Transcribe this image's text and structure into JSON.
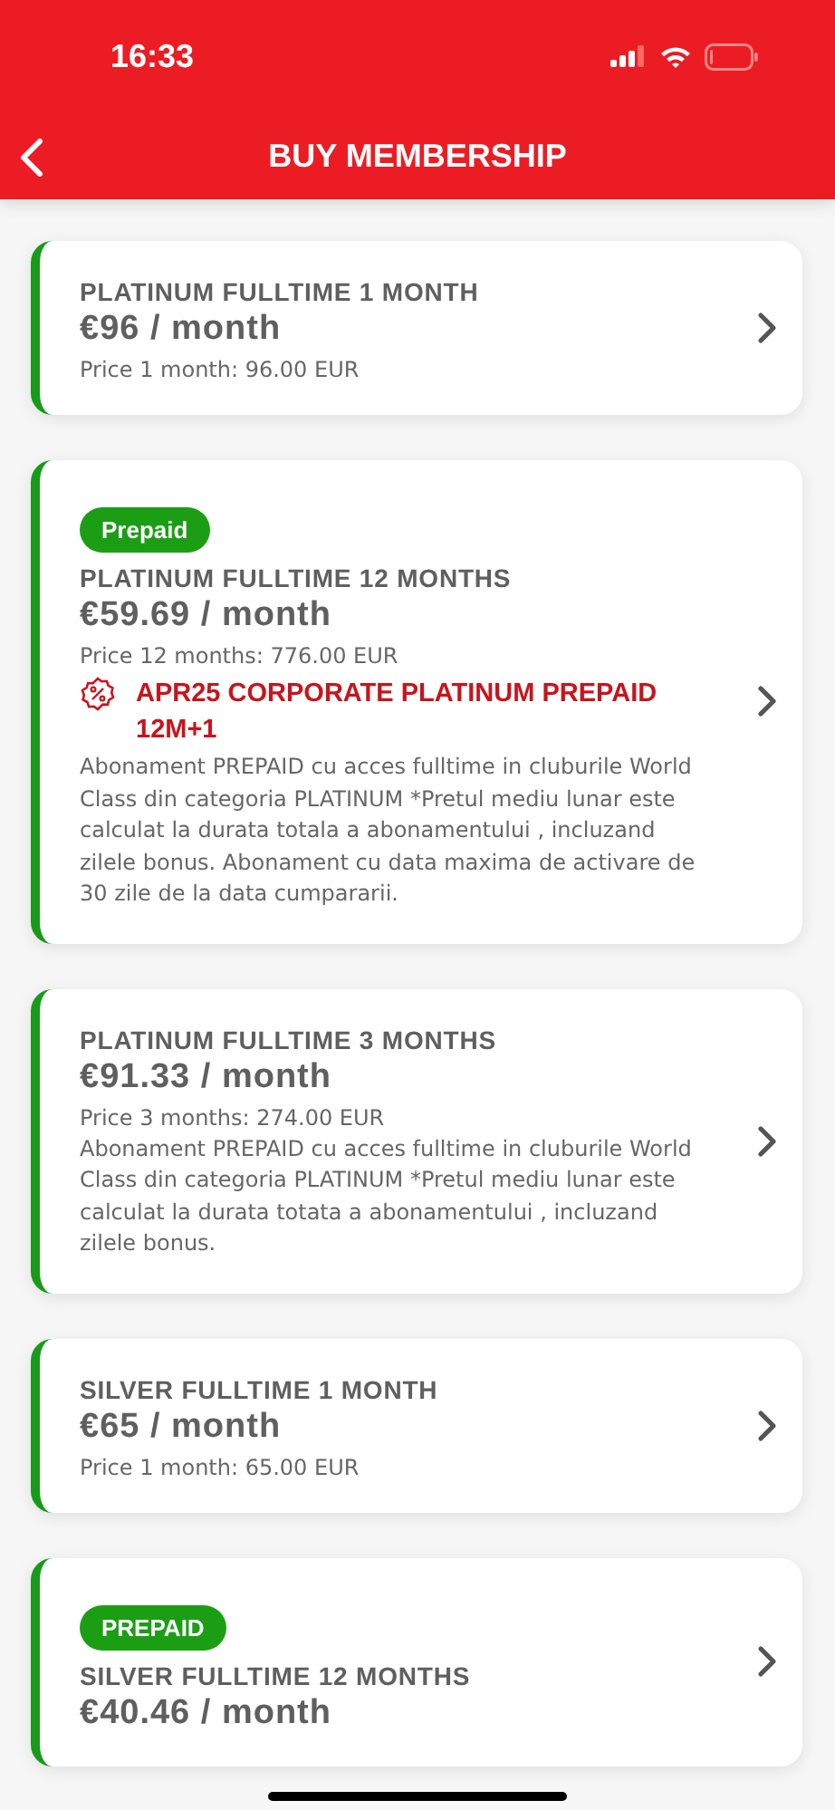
{
  "status_bar": {
    "time": "16:33"
  },
  "header": {
    "title": "BUY MEMBERSHIP"
  },
  "memberships": [
    {
      "title": "PLATINUM FULLTIME 1 MONTH",
      "price": "€96 / month",
      "price_note": "Price 1 month: 96.00 EUR"
    },
    {
      "badge": "Prepaid",
      "title": "PLATINUM FULLTIME 12 MONTHS",
      "price": "€59.69 / month",
      "price_note": "Price 12 months: 776.00 EUR",
      "promo": "APR25 CORPORATE PLATINUM PREPAID 12M+1",
      "description": "Abonament PREPAID cu acces fulltime in cluburile World Class din categoria PLATINUM *Pretul mediu lunar este calculat la durata totala a abonamentului , incluzand zilele bonus. Abonament cu data maxima de activare de 30 zile de la data cumpararii."
    },
    {
      "title": "PLATINUM FULLTIME 3 MONTHS",
      "price": "€91.33 / month",
      "price_note": "Price 3 months: 274.00 EUR",
      "description": "Abonament PREPAID cu acces fulltime in cluburile World Class din categoria PLATINUM  *Pretul mediu lunar este calculat la durata totata a abonamentului , incluzand zilele bonus."
    },
    {
      "title": "SILVER FULLTIME 1 MONTH",
      "price": "€65 / month",
      "price_note": "Price 1 month: 65.00 EUR"
    },
    {
      "badge": "PREPAID",
      "title": "SILVER FULLTIME 12 MONTHS",
      "price": "€40.46 / month"
    }
  ]
}
